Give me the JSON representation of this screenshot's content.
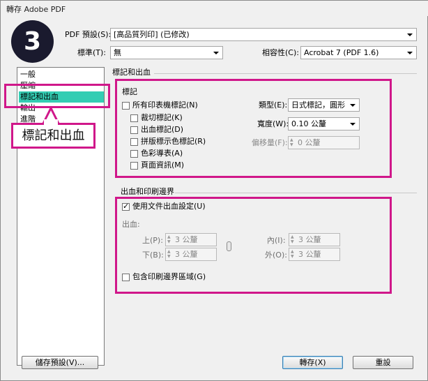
{
  "window": {
    "title": "轉存 Adobe PDF"
  },
  "badge": {
    "number": "3"
  },
  "callout": {
    "text": "標記和出血"
  },
  "top": {
    "preset_label": "PDF 預設(S):",
    "preset_value": "[高品質列印] (已修改)",
    "standard_label": "標準(T):",
    "standard_value": "無",
    "compat_label": "相容性(C):",
    "compat_value": "Acrobat 7 (PDF 1.6)"
  },
  "sidebar": {
    "items": [
      {
        "label": "一般"
      },
      {
        "label": "壓縮"
      },
      {
        "label": "標記和出血"
      },
      {
        "label": "輸出"
      },
      {
        "label": "進階"
      }
    ]
  },
  "section_heading": "標記和出血",
  "marks": {
    "heading": "標記",
    "all_marks": "所有印表機標記(N)",
    "crop": "裁切標記(K)",
    "bleed": "出血標記(D)",
    "registration": "拼版標示色標記(R)",
    "color_bars": "色彩導表(A)",
    "page_info": "頁面資訊(M)",
    "type_label": "類型(E):",
    "type_value": "日式標記，圓形",
    "weight_label": "寬度(W):",
    "weight_value": "0.10 公釐",
    "offset_label": "偏移量(F):",
    "offset_value": "0 公釐"
  },
  "bleed_slug": {
    "heading": "出血和印刷邊界",
    "use_doc": "使用文件出血設定(U)",
    "use_doc_checked": true,
    "bleed_label": "出血:",
    "top_label": "上(P):",
    "top_value": "3 公釐",
    "bottom_label": "下(B):",
    "bottom_value": "3 公釐",
    "inside_label": "內(I):",
    "inside_value": "3 公釐",
    "outside_label": "外(O):",
    "outside_value": "3 公釐",
    "include_slug": "包含印刷邊界區域(G)"
  },
  "buttons": {
    "save_preset": "儲存預設(V)...",
    "export": "轉存(X)",
    "reset": "重設"
  },
  "colors": {
    "highlight": "#d0178a",
    "selection": "#33cdb3"
  }
}
